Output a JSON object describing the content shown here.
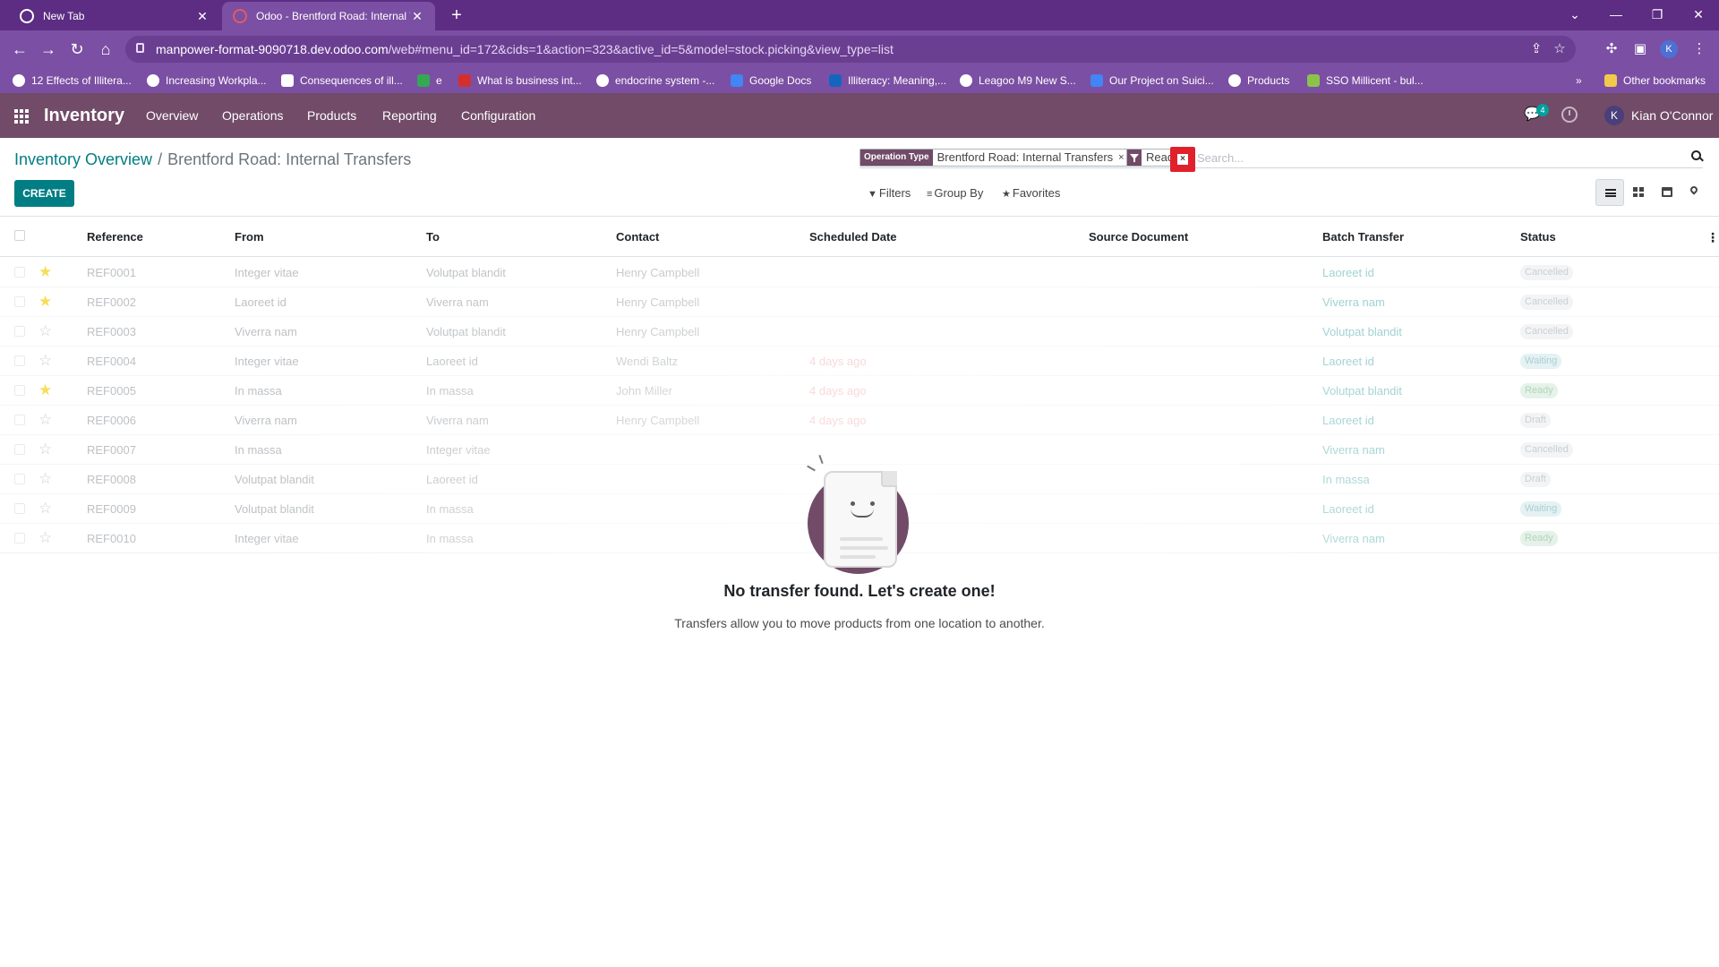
{
  "browser": {
    "tabs": [
      {
        "label": "New Tab"
      },
      {
        "label": "Odoo - Brentford Road: Internal Tr"
      }
    ],
    "url_host": "manpower-format-9090718.dev.odoo.com",
    "url_path": "/web#menu_id=172&cids=1&action=323&active_id=5&model=stock.picking&view_type=list",
    "profile_initial": "K",
    "bookmarks": [
      {
        "label": "12 Effects of Illitera..."
      },
      {
        "label": "Increasing Workpla..."
      },
      {
        "label": "Consequences of ill..."
      },
      {
        "label": "e"
      },
      {
        "label": "What is business int..."
      },
      {
        "label": "endocrine system -..."
      },
      {
        "label": "Google Docs"
      },
      {
        "label": "Illiteracy: Meaning,..."
      },
      {
        "label": "Leagoo M9 New S..."
      },
      {
        "label": "Our Project on Suici..."
      },
      {
        "label": "Products"
      },
      {
        "label": "SSO Millicent - bul..."
      },
      {
        "label": "Other bookmarks"
      }
    ]
  },
  "odoo": {
    "app_name": "Inventory",
    "menu": [
      "Overview",
      "Operations",
      "Products",
      "Reporting",
      "Configuration"
    ],
    "messages_count": "4",
    "user_initial": "K",
    "user_name": "Kian O'Connor"
  },
  "control_panel": {
    "breadcrumb_parent": "Inventory Overview",
    "breadcrumb_sep": "/",
    "breadcrumb_current": "Brentford Road: Internal Transfers",
    "create_label": "CREATE",
    "facet_category": "Operation Type",
    "facet_value": "Brentford Road: Internal Transfers",
    "facet2_value": "Ready",
    "facet_remove": "×",
    "search_placeholder": "Search...",
    "filters_label": "Filters",
    "groupby_label": "Group By",
    "favorites_label": "Favorites"
  },
  "table": {
    "headers": [
      "Reference",
      "From",
      "To",
      "Contact",
      "Scheduled Date",
      "Source Document",
      "Batch Transfer",
      "Status"
    ],
    "rows": [
      {
        "starred": true,
        "ref": "REF0001",
        "from": "Integer vitae",
        "to": "Volutpat blandit",
        "contact": "Henry Campbell",
        "date": "",
        "batch": "Laoreet id",
        "status": "Cancelled",
        "status_kind": "cancelled"
      },
      {
        "starred": true,
        "ref": "REF0002",
        "from": "Laoreet id",
        "to": "Viverra nam",
        "contact": "Henry Campbell",
        "date": "",
        "batch": "Viverra nam",
        "status": "Cancelled",
        "status_kind": "cancelled"
      },
      {
        "starred": false,
        "ref": "REF0003",
        "from": "Viverra nam",
        "to": "Volutpat blandit",
        "contact": "Henry Campbell",
        "date": "",
        "batch": "Volutpat blandit",
        "status": "Cancelled",
        "status_kind": "cancelled"
      },
      {
        "starred": false,
        "ref": "REF0004",
        "from": "Integer vitae",
        "to": "Laoreet id",
        "contact": "Wendi Baltz",
        "date": "4 days ago",
        "batch": "Laoreet id",
        "status": "Waiting",
        "status_kind": "waiting"
      },
      {
        "starred": true,
        "ref": "REF0005",
        "from": "In massa",
        "to": "In massa",
        "contact": "John Miller",
        "date": "4 days ago",
        "batch": "Volutpat blandit",
        "status": "Ready",
        "status_kind": "ready"
      },
      {
        "starred": false,
        "ref": "REF0006",
        "from": "Viverra nam",
        "to": "Viverra nam",
        "contact": "Henry Campbell",
        "date": "4 days ago",
        "batch": "Laoreet id",
        "status": "Draft",
        "status_kind": "draft"
      },
      {
        "starred": false,
        "ref": "REF0007",
        "from": "In massa",
        "to": "Integer vitae",
        "contact": "",
        "date": "",
        "batch": "Viverra nam",
        "status": "Cancelled",
        "status_kind": "cancelled"
      },
      {
        "starred": false,
        "ref": "REF0008",
        "from": "Volutpat blandit",
        "to": "Laoreet id",
        "contact": "",
        "date": "",
        "batch": "In massa",
        "status": "Draft",
        "status_kind": "draft"
      },
      {
        "starred": false,
        "ref": "REF0009",
        "from": "Volutpat blandit",
        "to": "In massa",
        "contact": "",
        "date": "",
        "batch": "Laoreet id",
        "status": "Waiting",
        "status_kind": "waiting"
      },
      {
        "starred": false,
        "ref": "REF0010",
        "from": "Integer vitae",
        "to": "In massa",
        "contact": "",
        "date": "",
        "batch": "Viverra nam",
        "status": "Ready",
        "status_kind": "ready"
      }
    ]
  },
  "help": {
    "title": "No transfer found. Let's create one!",
    "text": "Transfers allow you to move products from one location to another."
  },
  "colors": {
    "browser_chrome": "#7b4fa3",
    "odoo_primary": "#714b67",
    "odoo_accent": "#017e84",
    "facet_remove_highlight": "#e0212b",
    "star_active": "#f3cc00"
  }
}
